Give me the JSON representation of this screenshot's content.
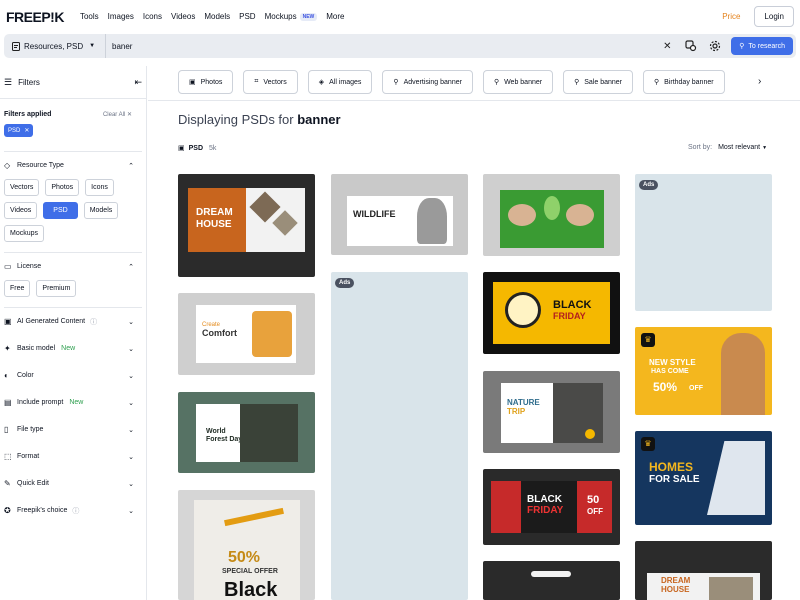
{
  "nav": {
    "logo": "FREEP!K",
    "items": [
      "Tools",
      "Images",
      "Icons",
      "Videos",
      "Models",
      "PSD",
      "Mockups",
      "More"
    ],
    "new_badge": "NEW",
    "price": "Price",
    "login": "Login"
  },
  "search": {
    "scope": "Resources, PSD",
    "query": "baner",
    "research": "To research"
  },
  "sidebar": {
    "title": "Filters",
    "applied_label": "Filters applied",
    "clear_all": "Clear All",
    "applied_chip": "PSD",
    "resource_type": {
      "label": "Resource Type",
      "options": [
        "Vectors",
        "Photos",
        "Icons",
        "Videos",
        "PSD",
        "Models",
        "Mockups"
      ]
    },
    "license": {
      "label": "License",
      "options": [
        "Free",
        "Premium"
      ]
    },
    "sections": {
      "ai": "AI Generated Content",
      "basic": "Basic model",
      "basic_new": "New",
      "color": "Color",
      "prompt": "Include prompt",
      "prompt_new": "New",
      "filetype": "File type",
      "format": "Format",
      "quickedit": "Quick Edit",
      "choice": "Freepik's choice"
    }
  },
  "chips": [
    "Photos",
    "Vectors",
    "All images",
    "Advertising banner",
    "Web banner",
    "Sale banner",
    "Birthday banner"
  ],
  "heading": {
    "prefix": "Displaying PSDs for",
    "term": "banner"
  },
  "count": {
    "label": "PSD",
    "value": "5k"
  },
  "sort": {
    "label": "Sort by:",
    "value": "Most relevant"
  },
  "ads_label": "Ads",
  "cards": {
    "dream": [
      "DREAM",
      "HOUSE"
    ],
    "wildlife": "WILDLIFE",
    "comfort": [
      "Create",
      "Comfort"
    ],
    "forest": [
      "World",
      "Forest Day"
    ],
    "sale50": [
      "50%",
      "SPECIAL OFFER",
      "Black"
    ],
    "black_friday": [
      "BLACK",
      "FRIDAY"
    ],
    "nature": [
      "NATURE",
      "TRIP"
    ],
    "bf2": [
      "BLACK",
      "FRIDAY",
      "50",
      "OFF"
    ],
    "new_style": [
      "NEW STYLE",
      "HAS COME",
      "50%",
      "OFF"
    ],
    "homes": [
      "HOMES",
      "FOR SALE"
    ],
    "dream2": [
      "DREAM",
      "HOUSE"
    ]
  }
}
